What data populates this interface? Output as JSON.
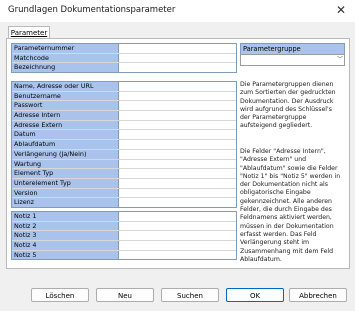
{
  "window": {
    "title": "Grundlagen Dokumentationsparameter"
  },
  "tab": {
    "label": "Parameter"
  },
  "groups": [
    {
      "labels": [
        "Parameternummer",
        "Matchcode",
        "Bezeichnung"
      ]
    },
    {
      "labels": [
        "Name, Adresse oder URL",
        "Benutzername",
        "Passwort",
        "Adresse Intern",
        "Adresse Extern",
        "Datum",
        "Ablaufdatum",
        "Verlängerung (Ja/Nein)",
        "Wartung",
        "Element Typ",
        "Unterelement Typ",
        "Version",
        "Lizenz"
      ]
    },
    {
      "labels": [
        "Notiz 1",
        "Notiz 2",
        "Notiz 3",
        "Notiz 4",
        "Notiz 5"
      ]
    }
  ],
  "parametergruppe": {
    "label": "Parametergruppe",
    "value": ""
  },
  "help": {
    "text1": "Die Parametergruppen dienen zum Sortierten der gedruckten Dokumentation. Der Ausdruck wird aufgrund des Schlüssel's der Parametergruppe aufsteigend gegliedert.",
    "text2": "Die Felder \"Adresse Intern\", \"Adresse Extern\" und \"Ablaufdatum\" sowie die Felder \"Notiz 1\" bis \"Notiz 5\" werden in der Dokumentation nicht als obligatorische Eingabe gekennzeichnet. Alle anderen Felder, die durch Eingabe des Feldnamens aktiviert werden, müssen in der Dokumentation erfasst werden. Das Feld Verlängerung steht im Zusammenhang mit dem Feld Ablaufdatum."
  },
  "buttons": {
    "delete": "Löschen",
    "new": "Neu",
    "search": "Suchen",
    "ok": "OK",
    "cancel": "Abbrechen"
  }
}
